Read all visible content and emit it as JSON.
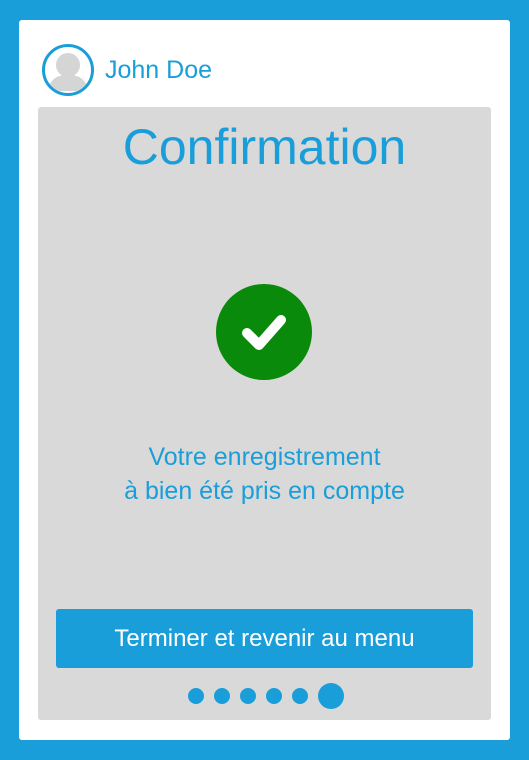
{
  "user": {
    "name": "John Doe",
    "avatar_icon": "user-avatar-icon"
  },
  "screen": {
    "title": "Confirmation",
    "status_icon": "checkmark-icon",
    "message_line1": "Votre enregistrement",
    "message_line2": "à bien été pris en compte",
    "button_label": "Terminer et revenir au menu"
  },
  "pager": {
    "total_steps": 6,
    "current_step": 6
  },
  "colors": {
    "accent": "#1a9ed9",
    "panel": "#d9d9d9",
    "success": "#0a8a0a",
    "surface": "#ffffff"
  }
}
